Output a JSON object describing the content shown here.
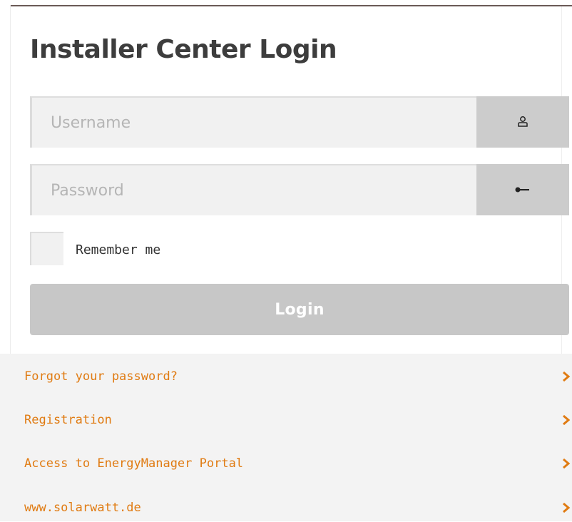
{
  "page": {
    "title": "Installer Center Login"
  },
  "form": {
    "username_placeholder": "Username",
    "password_placeholder": "Password",
    "remember_label": "Remember me",
    "login_label": "Login"
  },
  "icons": {
    "username": "user-icon",
    "password": "key-icon",
    "link_arrow": "chevron-right-icon"
  },
  "links": [
    {
      "label": "Forgot your password?"
    },
    {
      "label": "Registration"
    },
    {
      "label": "Access to EnergyManager Portal"
    },
    {
      "label": "www.solarwatt.de"
    }
  ],
  "colors": {
    "link": "#e07b12",
    "title": "#3d3d3d",
    "login_button": "#c7c7c7",
    "addon": "#cccccc",
    "footer_bg": "#f3f3f3"
  }
}
